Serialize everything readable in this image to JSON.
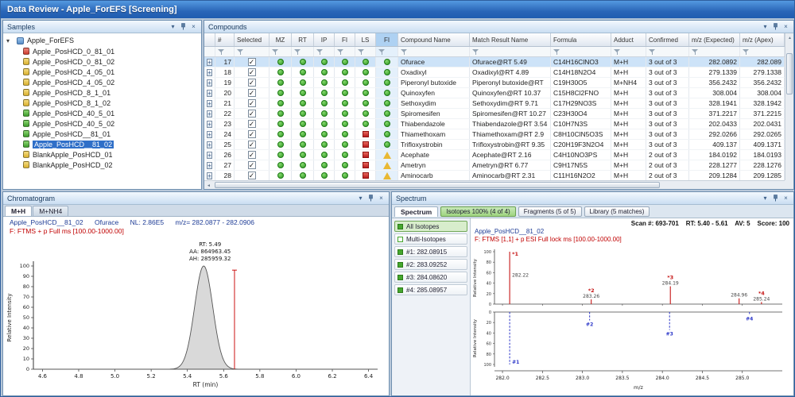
{
  "window": {
    "title": "Data Review - Apple_ForEFS [Screening]"
  },
  "icons": {
    "chevron_down": "▾",
    "close": "×",
    "check": "✓",
    "expand": "+",
    "tree_expanded": "▾",
    "scroll_up": "▲",
    "scroll_down": "▼",
    "scroll_left": "◄",
    "scroll_right": "►"
  },
  "panels": {
    "samples": {
      "title": "Samples"
    },
    "compounds": {
      "title": "Compounds"
    },
    "chromatogram": {
      "title": "Chromatogram"
    },
    "spectrum": {
      "title": "Spectrum"
    }
  },
  "samples": {
    "root": "Apple_ForEFS",
    "items": [
      {
        "label": "Apple_PosHCD_0_81_01",
        "status": "red"
      },
      {
        "label": "Apple_PosHCD_0_81_02",
        "status": "yellow"
      },
      {
        "label": "Apple_PosHCD_4_05_01",
        "status": "yellow"
      },
      {
        "label": "Apple_PosHCD_4_05_02",
        "status": "yellow"
      },
      {
        "label": "Apple_PosHCD_8_1_01",
        "status": "yellow"
      },
      {
        "label": "Apple_PosHCD_8_1_02",
        "status": "yellow"
      },
      {
        "label": "Apple_PosHCD_40_5_01",
        "status": "green"
      },
      {
        "label": "Apple_PosHCD_40_5_02",
        "status": "green"
      },
      {
        "label": "Apple_PosHCD__81_01",
        "status": "green"
      },
      {
        "label": "Apple_PosHCD__81_02",
        "status": "green",
        "selected": true
      },
      {
        "label": "BlankApple_PosHCD_01",
        "status": "yellow"
      },
      {
        "label": "BlankApple_PosHCD_02",
        "status": "yellow"
      }
    ]
  },
  "compounds": {
    "columns": [
      "",
      "#",
      "Selected",
      "MZ",
      "RT",
      "IP",
      "FI",
      "LS",
      "FI",
      "Compound Name",
      "Match Result Name",
      "Formula",
      "Adduct",
      "Confirmed",
      "m/z (Expected)",
      "m/z (Apex)"
    ],
    "highlighted_column_index": 8,
    "rows": [
      {
        "n": "17",
        "checked": true,
        "status": [
          "g",
          "g",
          "g",
          "g",
          "g",
          "g"
        ],
        "name": "Ofurace",
        "match": "Ofurace@RT 5.49",
        "formula": "C14H16ClNO3",
        "adduct": "M+H",
        "confirmed": "3 out of 3",
        "mz_expected": "282.0892",
        "mz_apex": "282.089",
        "selected": true
      },
      {
        "n": "18",
        "checked": true,
        "status": [
          "g",
          "g",
          "g",
          "g",
          "g",
          "g"
        ],
        "name": "Oxadixyl",
        "match": "Oxadixyl@RT 4.89",
        "formula": "C14H18N2O4",
        "adduct": "M+H",
        "confirmed": "3 out of 3",
        "mz_expected": "279.1339",
        "mz_apex": "279.1338"
      },
      {
        "n": "19",
        "checked": true,
        "status": [
          "g",
          "g",
          "g",
          "g",
          "g",
          "g"
        ],
        "name": "Piperonyl butoxide",
        "match": "Piperonyl butoxide@RT",
        "formula": "C19H30O5",
        "adduct": "M+NH4",
        "confirmed": "3 out of 3",
        "mz_expected": "356.2432",
        "mz_apex": "356.2432"
      },
      {
        "n": "20",
        "checked": true,
        "status": [
          "g",
          "g",
          "g",
          "g",
          "g",
          "g"
        ],
        "name": "Quinoxyfen",
        "match": "Quinoxyfen@RT 10.37",
        "formula": "C15H8Cl2FNO",
        "adduct": "M+H",
        "confirmed": "3 out of 3",
        "mz_expected": "308.004",
        "mz_apex": "308.004"
      },
      {
        "n": "21",
        "checked": true,
        "status": [
          "g",
          "g",
          "g",
          "g",
          "g",
          "g"
        ],
        "name": "Sethoxydim",
        "match": "Sethoxydim@RT 9.71",
        "formula": "C17H29NO3S",
        "adduct": "M+H",
        "confirmed": "3 out of 3",
        "mz_expected": "328.1941",
        "mz_apex": "328.1942"
      },
      {
        "n": "22",
        "checked": true,
        "status": [
          "g",
          "g",
          "g",
          "g",
          "g",
          "g"
        ],
        "name": "Spiromesifen",
        "match": "Spiromesifen@RT 10.27",
        "formula": "C23H30O4",
        "adduct": "M+H",
        "confirmed": "3 out of 3",
        "mz_expected": "371.2217",
        "mz_apex": "371.2215"
      },
      {
        "n": "23",
        "checked": true,
        "status": [
          "g",
          "g",
          "g",
          "g",
          "g",
          "g"
        ],
        "name": "Thiabendazole",
        "match": "Thiabendazole@RT 3.54",
        "formula": "C10H7N3S",
        "adduct": "M+H",
        "confirmed": "3 out of 3",
        "mz_expected": "202.0433",
        "mz_apex": "202.0431"
      },
      {
        "n": "24",
        "checked": true,
        "status": [
          "g",
          "g",
          "g",
          "g",
          "r",
          "g"
        ],
        "name": "Thiamethoxam",
        "match": "Thiamethoxam@RT 2.9",
        "formula": "C8H10ClN5O3S",
        "adduct": "M+H",
        "confirmed": "3 out of 3",
        "mz_expected": "292.0266",
        "mz_apex": "292.0265"
      },
      {
        "n": "25",
        "checked": true,
        "status": [
          "g",
          "g",
          "g",
          "g",
          "r",
          "g"
        ],
        "name": "Trifloxystrobin",
        "match": "Trifloxystrobin@RT 9.35",
        "formula": "C20H19F3N2O4",
        "adduct": "M+H",
        "confirmed": "3 out of 3",
        "mz_expected": "409.137",
        "mz_apex": "409.1371"
      },
      {
        "n": "26",
        "checked": true,
        "status": [
          "g",
          "g",
          "g",
          "g",
          "r",
          "y"
        ],
        "name": "Acephate",
        "match": "Acephate@RT 2.16",
        "formula": "C4H10NO3PS",
        "adduct": "M+H",
        "confirmed": "2 out of 3",
        "mz_expected": "184.0192",
        "mz_apex": "184.0193"
      },
      {
        "n": "27",
        "checked": true,
        "status": [
          "g",
          "g",
          "g",
          "g",
          "r",
          "y"
        ],
        "name": "Ametryn",
        "match": "Ametryn@RT 6.77",
        "formula": "C9H17N5S",
        "adduct": "M+H",
        "confirmed": "2 out of 3",
        "mz_expected": "228.1277",
        "mz_apex": "228.1276"
      },
      {
        "n": "28",
        "checked": true,
        "status": [
          "g",
          "g",
          "g",
          "g",
          "r",
          "y"
        ],
        "name": "Aminocarb",
        "match": "Aminocarb@RT 2.31",
        "formula": "C11H16N2O2",
        "adduct": "M+H",
        "confirmed": "2 out of 3",
        "mz_expected": "209.1284",
        "mz_apex": "209.1285"
      }
    ]
  },
  "spectrum_panel": {
    "tab": "Spectrum",
    "buttons": [
      {
        "label": "Isotopes 100% (4 of 4)",
        "style": "green"
      },
      {
        "label": "Fragments (5 of 5)",
        "style": "plain"
      },
      {
        "label": "Library (5 matches)",
        "style": "plain"
      }
    ],
    "isotope_list": [
      {
        "label": "All Isotopes",
        "selected": true,
        "icon": "green"
      },
      {
        "label": "Multi-Isotopes",
        "icon": "outline"
      },
      {
        "label": "#1: 282.08915",
        "icon": "green"
      },
      {
        "label": "#2: 283.09252",
        "icon": "green"
      },
      {
        "label": "#3: 284.08620",
        "icon": "green"
      },
      {
        "label": "#4: 285.08957",
        "icon": "green"
      }
    ]
  },
  "chart_data": [
    {
      "type": "area",
      "name": "chromatogram",
      "tabs": [
        "M+H",
        "M+NH4"
      ],
      "active_tab": "M+H",
      "sample": "Apple_PosHCD__81_02",
      "compound": "Ofurace",
      "nl": "NL: 2.86E5",
      "mz_range": "m/z= 282.0877 - 282.0906",
      "scan_filter": "F: FTMS + p Full ms [100.00-1000.00]",
      "peak": {
        "rt": 5.49,
        "sigma": 0.05,
        "height": 100
      },
      "annotations": [
        "RT: 5.49",
        "AA: 864963.45",
        "AH: 285959.32"
      ],
      "marker_x": 5.66,
      "xlim": [
        4.55,
        6.45
      ],
      "xticks": [
        4.6,
        4.8,
        5.0,
        5.2,
        5.4,
        5.6,
        5.8,
        6.0,
        6.2,
        6.4
      ],
      "ylim": [
        0,
        100
      ],
      "ytick_step": 10,
      "xlabel": "RT (min)",
      "ylabel": "Relative Intensity"
    },
    {
      "type": "stem-mirror",
      "name": "spectrum",
      "sample": "Apple_PosHCD__81_02",
      "scan_info": "Scan #: 693-701    RT: 5.40 - 5.61    AV: 5    Score: 100",
      "scan_filter": "F: FTMS [1,1] + p ESI Full lock ms [100.00-1000.00]",
      "xlim": [
        281.9,
        285.5
      ],
      "xticks": [
        282.0,
        282.5,
        283.0,
        283.5,
        284.0,
        284.5,
        285.0
      ],
      "ylim": [
        0,
        100
      ],
      "ytick_step": 20,
      "xlabel": "m/z",
      "ylabel": "Relative Intensity",
      "measured_color": "#c61616",
      "reference_color": "#2a35c8",
      "measured": [
        {
          "mz": 282.09,
          "rel": 100,
          "mark": "*1",
          "label": "282.22"
        },
        {
          "mz": 283.11,
          "rel": 9,
          "mark": "*2",
          "label": "283.26"
        },
        {
          "mz": 284.1,
          "rel": 34,
          "mark": "*3",
          "label": "284.19"
        },
        {
          "mz": 284.96,
          "rel": 11,
          "label": "284.96"
        },
        {
          "mz": 285.24,
          "rel": 4,
          "mark": "*4",
          "label": "285.24"
        }
      ],
      "reference": [
        {
          "mz": 282.09,
          "rel": 100,
          "mark": "#1"
        },
        {
          "mz": 283.09,
          "rel": 16,
          "mark": "#2"
        },
        {
          "mz": 284.09,
          "rel": 34,
          "mark": "#3"
        },
        {
          "mz": 285.09,
          "rel": 5,
          "mark": "#4"
        }
      ]
    }
  ]
}
